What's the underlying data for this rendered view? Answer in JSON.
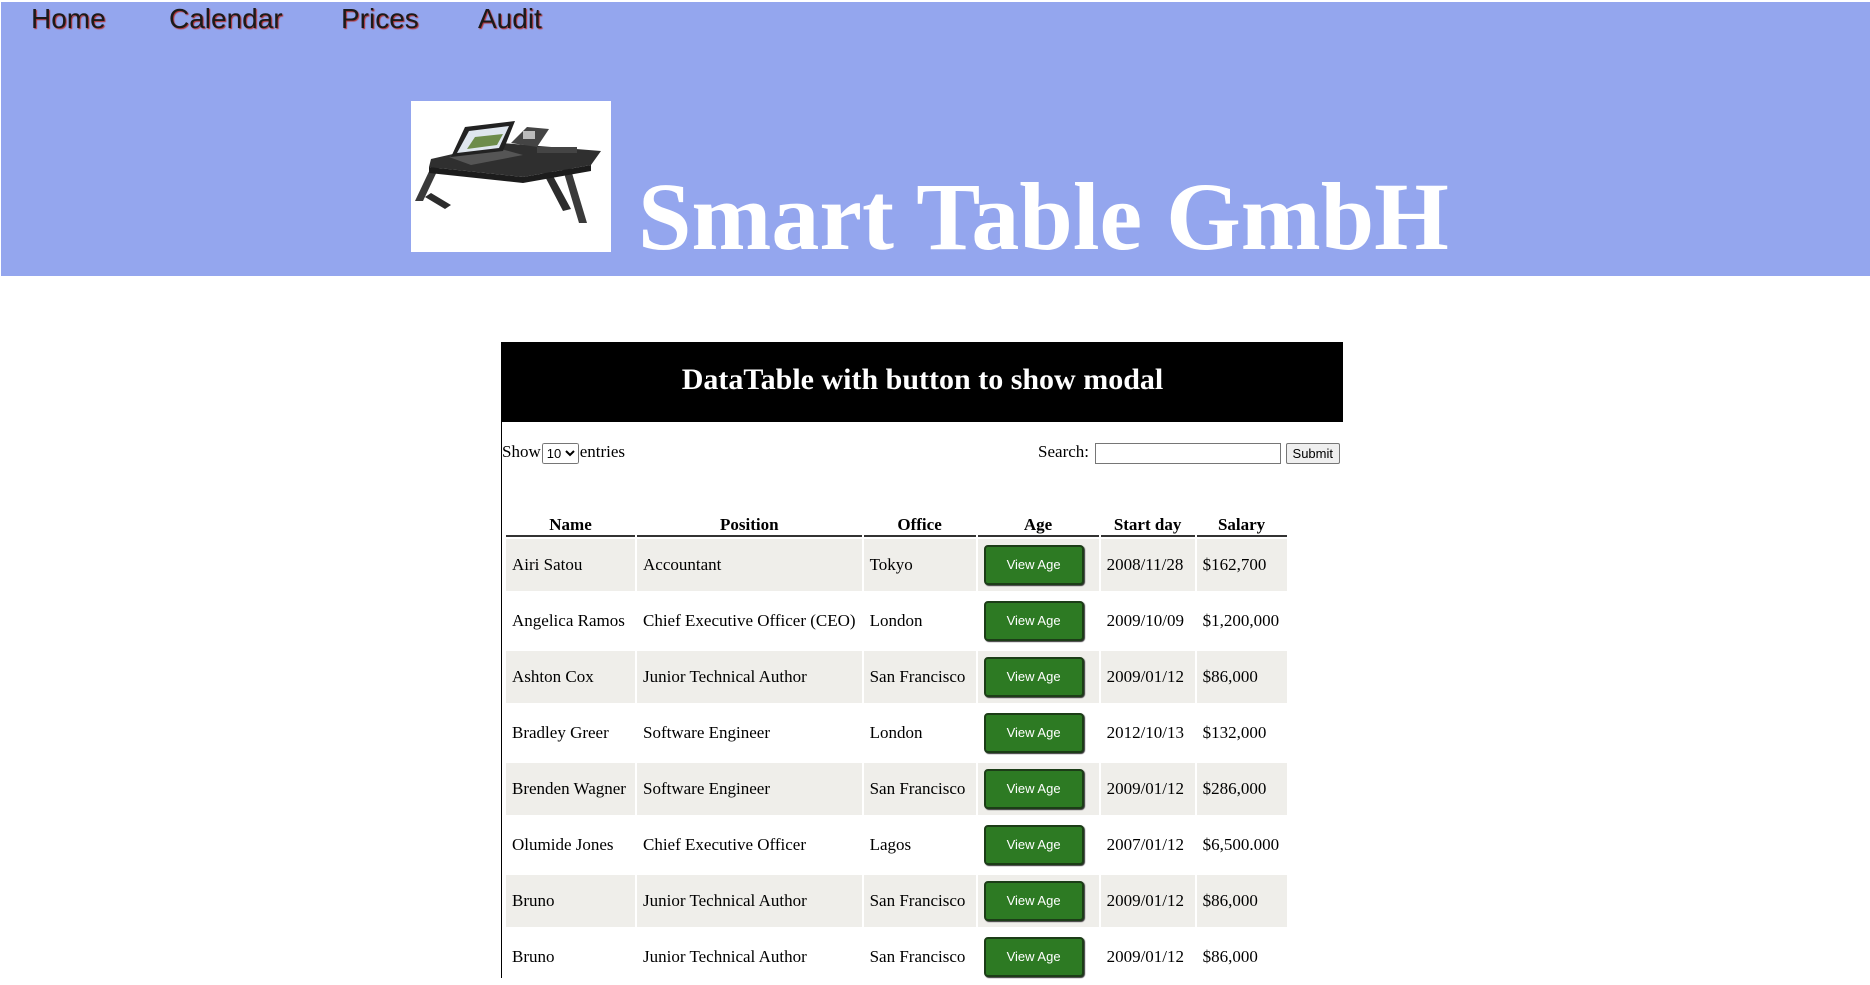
{
  "nav": {
    "items": [
      {
        "label": "Home"
      },
      {
        "label": "Calendar"
      },
      {
        "label": "Prices"
      },
      {
        "label": "Audit"
      }
    ]
  },
  "brand": {
    "title": "Smart Table GmbH",
    "logo_icon": "smart-table-laptop-desk-image"
  },
  "panel": {
    "heading": "DataTable with button to show modal",
    "show_prefix": "Show",
    "page_size": "10",
    "show_suffix": "entries",
    "search_label": "Search:",
    "search_value": "",
    "submit_label": "Submit"
  },
  "table": {
    "columns": [
      "Name",
      "Position",
      "Office",
      "Age",
      "Start day",
      "Salary"
    ],
    "age_button_label": "View Age",
    "rows": [
      {
        "name": "Airi Satou",
        "position": "Accountant",
        "office": "Tokyo",
        "start": "2008/11/28",
        "salary": "$162,700"
      },
      {
        "name": "Angelica Ramos",
        "position": "Chief Executive Officer (CEO)",
        "office": "London",
        "start": "2009/10/09",
        "salary": "$1,200,000"
      },
      {
        "name": "Ashton Cox",
        "position": "Junior Technical Author",
        "office": "San Francisco",
        "start": "2009/01/12",
        "salary": "$86,000"
      },
      {
        "name": "Bradley Greer",
        "position": "Software Engineer",
        "office": "London",
        "start": "2012/10/13",
        "salary": "$132,000"
      },
      {
        "name": "Brenden Wagner",
        "position": "Software Engineer",
        "office": "San Francisco",
        "start": "2009/01/12",
        "salary": "$286,000"
      },
      {
        "name": "Olumide Jones",
        "position": "Chief Executive Officer",
        "office": "Lagos",
        "start": "2007/01/12",
        "salary": "$6,500.000"
      },
      {
        "name": "Bruno",
        "position": "Junior Technical Author",
        "office": "San Francisco",
        "start": "2009/01/12",
        "salary": "$86,000"
      },
      {
        "name": "Bruno",
        "position": "Junior Technical Author",
        "office": "San Francisco",
        "start": "2009/01/12",
        "salary": "$86,000"
      }
    ]
  },
  "colors": {
    "header_bg": "#94a6ee",
    "button_green": "#2d7a23",
    "row_stripe": "#efeeea"
  }
}
